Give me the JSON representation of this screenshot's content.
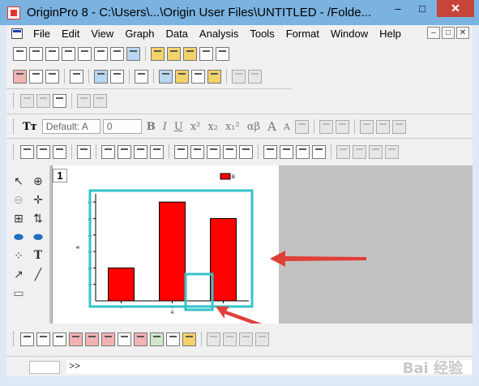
{
  "window": {
    "title": "OriginPro 8 - C:\\Users\\...\\Origin User Files\\UNTITLED - /Folde...",
    "minimize_glyph": "–",
    "maximize_glyph": "□",
    "close_glyph": "✕"
  },
  "menu": {
    "items": [
      "File",
      "Edit",
      "View",
      "Graph",
      "Data",
      "Analysis",
      "Tools",
      "Format",
      "Window",
      "Help"
    ],
    "mdi_buttons": [
      "–",
      "□",
      "✕"
    ]
  },
  "format_toolbar": {
    "font_prefix": "Tт",
    "font_name": "Default: A",
    "font_size": "0",
    "bold": "B",
    "italic": "I",
    "underline": "U",
    "superscript": "x²",
    "subscript": "x₂",
    "supersub": "x₁²",
    "greek": "αβ",
    "grow": "A",
    "shrink": "A"
  },
  "graph": {
    "page_number": "1",
    "chart_data": {
      "type": "bar",
      "categories": [
        "1",
        "2",
        "3"
      ],
      "values": [
        20,
        60,
        50
      ],
      "ylim": [
        0,
        65
      ],
      "yticks": [
        10,
        20,
        30,
        40,
        50,
        60
      ],
      "xlabel": "A",
      "ylabel": "B",
      "legend": "B",
      "bar_color": "#ff0000"
    },
    "highlight_color": "#33c3c9",
    "arrow_color": "#e04038"
  },
  "command": {
    "prompt": ">>"
  },
  "watermark": "Bai 经验"
}
